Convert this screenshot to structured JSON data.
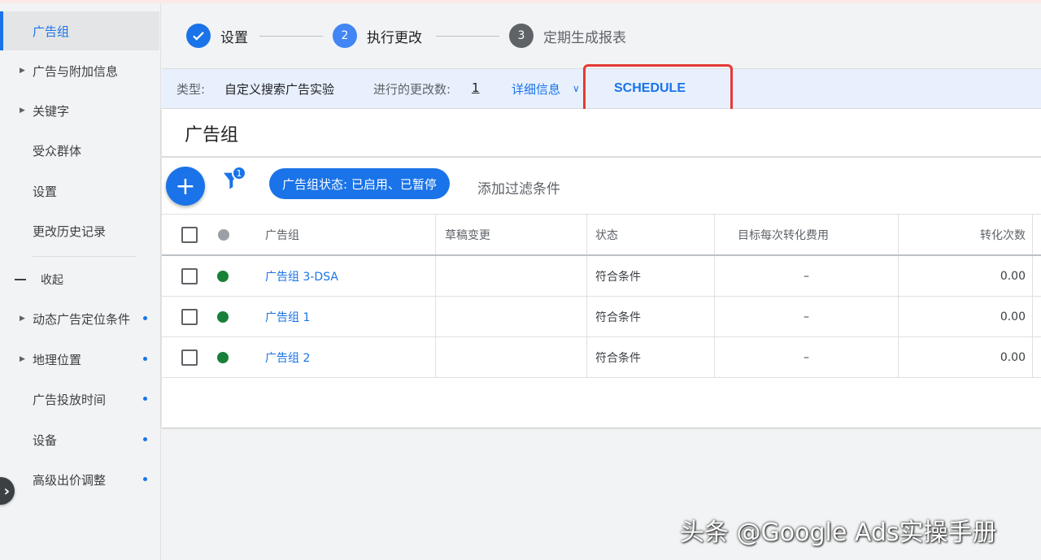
{
  "sidebar": {
    "items": [
      {
        "label": "广告组",
        "active": true
      },
      {
        "label": "广告与附加信息",
        "arrow": true
      },
      {
        "label": "关键字",
        "arrow": true
      },
      {
        "label": "受众群体"
      },
      {
        "label": "设置"
      },
      {
        "label": "更改历史记录"
      }
    ],
    "collapse_label": "收起",
    "more_items": [
      {
        "label": "动态广告定位条件",
        "arrow": true,
        "dot": true
      },
      {
        "label": "地理位置",
        "arrow": true,
        "dot": true
      },
      {
        "label": "广告投放时间",
        "dot": true
      },
      {
        "label": "设备",
        "dot": true
      },
      {
        "label": "高级出价调整",
        "dot": true
      }
    ]
  },
  "stepper": {
    "steps": [
      {
        "number": "✓",
        "label": "设置",
        "state": "done"
      },
      {
        "number": "2",
        "label": "执行更改",
        "state": "current"
      },
      {
        "number": "3",
        "label": "定期生成报表",
        "state": "upcoming"
      }
    ]
  },
  "infobar": {
    "type_label": "类型:",
    "type_value": "自定义搜索广告实验",
    "changes_label": "进行的更改数:",
    "changes_value": "1",
    "details_label": "详细信息",
    "schedule_label": "SCHEDULE"
  },
  "card": {
    "title": "广告组",
    "filter_count": "1",
    "status_chip": "广告组状态: 已启用、已暂停",
    "add_filter": "添加过滤条件"
  },
  "table": {
    "headers": [
      "广告组",
      "草稿变更",
      "状态",
      "目标每次转化费用",
      "转化次数"
    ],
    "rows": [
      {
        "name": "广告组 3-DSA",
        "draft": "",
        "status": "符合条件",
        "cpa": "–",
        "conversions": "0.00"
      },
      {
        "name": "广告组 1",
        "draft": "",
        "status": "符合条件",
        "cpa": "–",
        "conversions": "0.00"
      },
      {
        "name": "广告组 2",
        "draft": "",
        "status": "符合条件",
        "cpa": "–",
        "conversions": "0.00"
      }
    ]
  },
  "colors": {
    "accent": "#1a73e8",
    "enabled_dot": "#188038",
    "header_dot": "#9aa0a6",
    "highlight": "#e53935"
  },
  "watermark": "头条 @Google Ads实操手册"
}
